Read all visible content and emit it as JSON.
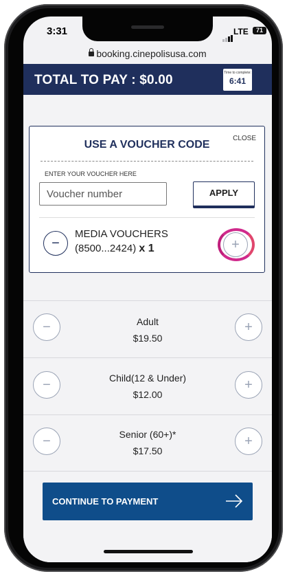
{
  "status": {
    "time": "3:31",
    "network": "LTE",
    "battery": "71"
  },
  "browser": {
    "url": "booking.cinepolisusa.com"
  },
  "header": {
    "total_label": "TOTAL TO PAY : $0.00",
    "timer_label": "Time to complete:",
    "timer_value": "6:41",
    "bg_color": "#1f2f5c"
  },
  "voucher": {
    "title": "USE A VOUCHER CODE",
    "close": "CLOSE",
    "input_label": "ENTER YOUR VOUCHER HERE",
    "input_placeholder": "Voucher number",
    "apply": "APPLY",
    "media_vouchers_label": "MEDIA VOUCHERS",
    "media_vouchers_code": "(8500...2424)",
    "media_vouchers_qty": "x 1"
  },
  "tickets": [
    {
      "name": "Adult",
      "price": "$19.50"
    },
    {
      "name": "Child(12 & Under)",
      "price": "$12.00"
    },
    {
      "name": "Senior (60+)*",
      "price": "$17.50"
    }
  ],
  "cta": {
    "label": "CONTINUE TO PAYMENT",
    "color": "#0f4d8a"
  },
  "icons": {
    "minus": "minus-icon",
    "plus": "plus-icon",
    "arrow": "arrow-right-icon",
    "lock": "lock-icon"
  }
}
